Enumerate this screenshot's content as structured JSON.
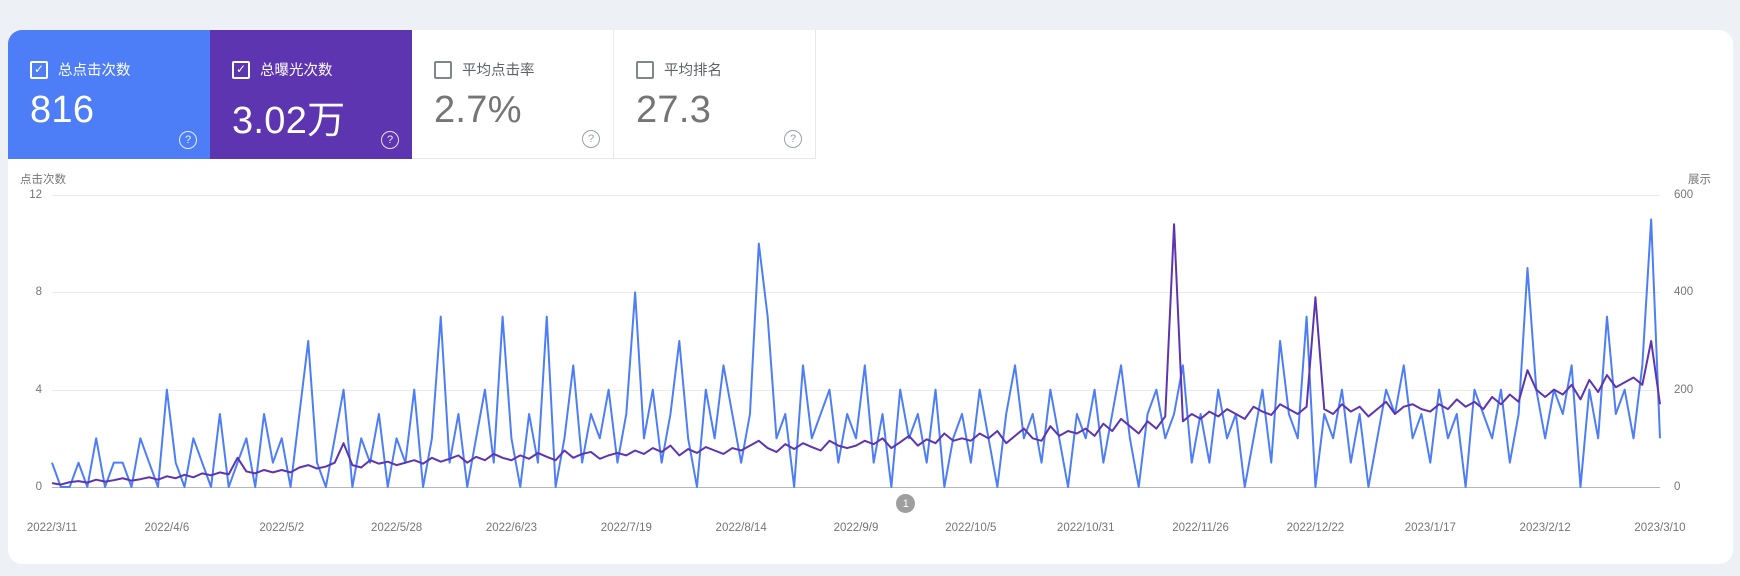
{
  "cards": [
    {
      "label": "总点击次数",
      "value": "816",
      "checked": true,
      "background": "#4d7ef7",
      "help_icon": "?"
    },
    {
      "label": "总曝光次数",
      "value": "3.02万",
      "checked": true,
      "background": "#5e35b1",
      "help_icon": "?"
    },
    {
      "label": "平均点击率",
      "value": "2.7%",
      "checked": false,
      "background": "#ffffff",
      "help_icon": "?"
    },
    {
      "label": "平均排名",
      "value": "27.3",
      "checked": false,
      "background": "#ffffff",
      "help_icon": "?"
    }
  ],
  "chart_data": {
    "type": "line",
    "title": "",
    "grid": "horizontal",
    "legend_position": "none",
    "axis_left": {
      "title": "点击次数",
      "ticks": [
        0,
        4,
        8,
        12
      ],
      "range": [
        0,
        12
      ]
    },
    "axis_right": {
      "title": "展示",
      "ticks": [
        0,
        200,
        400,
        600
      ],
      "range": [
        0,
        600
      ]
    },
    "x_tick_labels": [
      "2022/3/11",
      "2022/4/6",
      "2022/5/2",
      "2022/5/28",
      "2022/6/23",
      "2022/7/19",
      "2022/8/14",
      "2022/9/9",
      "2022/10/5",
      "2022/10/31",
      "2022/11/26",
      "2022/12/22",
      "2023/1/17",
      "2023/2/12",
      "2023/3/10"
    ],
    "x_note": "daily data 2022/3/11 - 2023/3/10 sampled every 2 days, 183 points",
    "series": [
      {
        "name": "点击次数",
        "axis": "left",
        "color": "#4d7ef7",
        "values": [
          1,
          0,
          0,
          1,
          0,
          2,
          0,
          1,
          1,
          0,
          2,
          1,
          0,
          4,
          1,
          0,
          2,
          1,
          0,
          3,
          0,
          1,
          2,
          0,
          3,
          1,
          2,
          0,
          3,
          6,
          1,
          0,
          2,
          4,
          0,
          2,
          1,
          3,
          0,
          2,
          1,
          4,
          0,
          2,
          7,
          1,
          3,
          0,
          2,
          4,
          1,
          7,
          2,
          0,
          3,
          1,
          7,
          0,
          2,
          5,
          1,
          3,
          2,
          4,
          1,
          3,
          8,
          2,
          4,
          1,
          3,
          6,
          2,
          0,
          4,
          2,
          5,
          3,
          1,
          3,
          10,
          7,
          2,
          3,
          0,
          5,
          2,
          3,
          4,
          1,
          3,
          2,
          5,
          1,
          3,
          0,
          4,
          2,
          3,
          1,
          4,
          0,
          2,
          3,
          1,
          4,
          2,
          0,
          3,
          5,
          2,
          3,
          1,
          4,
          2,
          0,
          3,
          2,
          4,
          1,
          3,
          5,
          2,
          0,
          3,
          4,
          2,
          3,
          5,
          1,
          3,
          1,
          4,
          2,
          3,
          0,
          2,
          4,
          1,
          6,
          3,
          2,
          7,
          0,
          3,
          2,
          4,
          1,
          3,
          0,
          2,
          4,
          3,
          5,
          2,
          3,
          1,
          4,
          2,
          3,
          0,
          4,
          3,
          2,
          4,
          1,
          3,
          9,
          4,
          2,
          4,
          3,
          5,
          0,
          4,
          2,
          7,
          3,
          4,
          2,
          5,
          11,
          2
        ]
      },
      {
        "name": "曝光次数",
        "axis": "right",
        "color": "#5e35b1",
        "values": [
          8,
          5,
          10,
          12,
          9,
          15,
          11,
          14,
          18,
          13,
          16,
          20,
          15,
          22,
          18,
          25,
          20,
          28,
          24,
          30,
          26,
          60,
          32,
          28,
          35,
          30,
          35,
          30,
          40,
          45,
          38,
          42,
          50,
          90,
          45,
          40,
          55,
          48,
          52,
          45,
          50,
          55,
          48,
          60,
          52,
          58,
          65,
          50,
          62,
          55,
          68,
          60,
          55,
          65,
          58,
          70,
          62,
          55,
          75,
          60,
          68,
          72,
          58,
          65,
          70,
          65,
          75,
          68,
          80,
          72,
          85,
          65,
          78,
          70,
          82,
          75,
          68,
          80,
          75,
          85,
          95,
          80,
          72,
          88,
          78,
          90,
          82,
          75,
          95,
          85,
          80,
          85,
          95,
          88,
          100,
          80,
          92,
          105,
          85,
          98,
          90,
          110,
          95,
          100,
          95,
          110,
          100,
          115,
          90,
          105,
          120,
          100,
          95,
          125,
          105,
          115,
          110,
          120,
          105,
          130,
          115,
          140,
          125,
          110,
          135,
          120,
          145,
          540,
          135,
          150,
          140,
          155,
          145,
          160,
          150,
          140,
          165,
          155,
          148,
          170,
          160,
          150,
          165,
          390,
          160,
          150,
          170,
          155,
          165,
          145,
          160,
          175,
          150,
          165,
          170,
          160,
          155,
          170,
          160,
          180,
          165,
          175,
          160,
          185,
          170,
          190,
          175,
          240,
          200,
          185,
          200,
          190,
          210,
          180,
          220,
          195,
          230,
          205,
          215,
          225,
          210,
          300,
          170
        ]
      }
    ],
    "annotation": {
      "label": "1",
      "x_fraction": 0.531,
      "color": "#9e9e9e"
    }
  }
}
